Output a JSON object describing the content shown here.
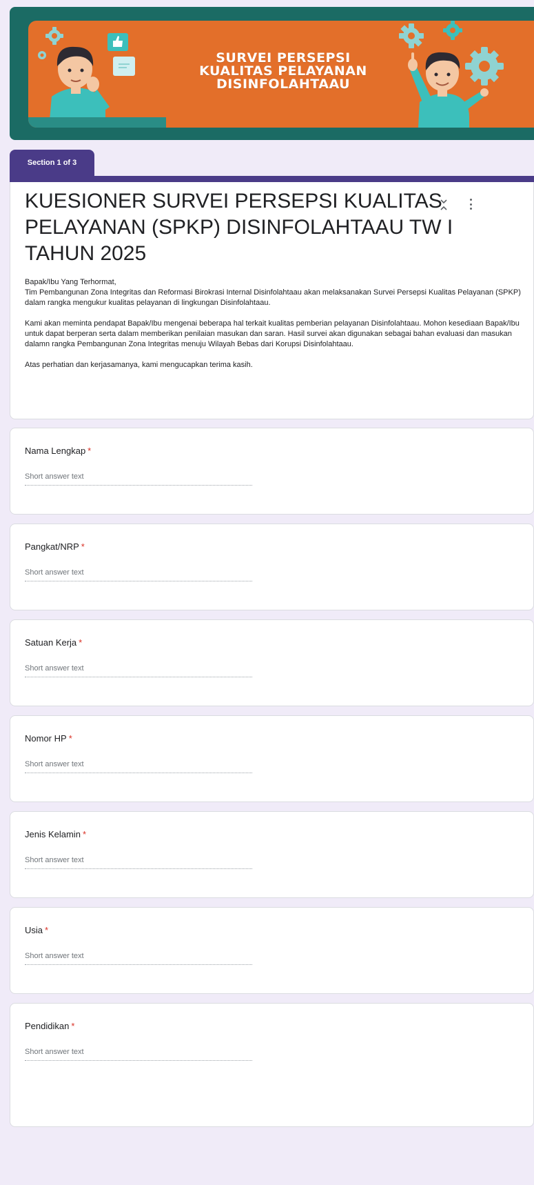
{
  "banner": {
    "title_line1": "SURVEI PERSEPSI",
    "title_line2": "KUALITAS PELAYANAN",
    "title_line3": "DISINFOLAHTAAU"
  },
  "section_label": "Section 1 of 3",
  "form": {
    "title": "KUESIONER SURVEI PERSEPSI KUALITAS PELAYANAN (SPKP) DISINFOLAHTAAU TW I TAHUN 2025",
    "description": {
      "greeting": "Bapak/Ibu Yang Terhormat,",
      "para1": "Tim Pembangunan Zona Integritas dan Reformasi Birokrasi Internal Disinfolahtaau akan melaksanakan Survei Persepsi Kualitas Pelayanan (SPKP) dalam rangka mengukur kualitas pelayanan di lingkungan Disinfolahtaau.",
      "para2": "Kami akan meminta pendapat Bapak/Ibu mengenai beberapa hal terkait kualitas pemberian pelayanan Disinfolahtaau. Mohon kesediaan Bapak/Ibu untuk dapat berperan serta dalam memberikan penilaian masukan dan saran. Hasil survei akan digunakan sebagai bahan evaluasi dan masukan dalamn rangka Pembangunan Zona Integritas menuju Wilayah Bebas dari Korupsi Disinfolahtaau.",
      "para3": "Atas perhatian dan kerjasamanya, kami mengucapkan terima kasih."
    }
  },
  "questions": [
    {
      "label": "Nama Lengkap",
      "required": "*",
      "placeholder": "Short answer text"
    },
    {
      "label": "Pangkat/NRP",
      "required": "*",
      "placeholder": "Short answer text"
    },
    {
      "label": "Satuan Kerja",
      "required": "*",
      "placeholder": "Short answer text"
    },
    {
      "label": "Nomor HP",
      "required": "*",
      "placeholder": "Short answer text"
    },
    {
      "label": "Jenis Kelamin",
      "required": "*",
      "placeholder": "Short answer text"
    },
    {
      "label": "Usia",
      "required": "*",
      "placeholder": "Short answer text"
    },
    {
      "label": "Pendidikan",
      "required": "*",
      "placeholder": "Short answer text"
    }
  ],
  "colors": {
    "background": "#f0ebf8",
    "accent": "#4a3b88",
    "banner_outer": "#1b6b64",
    "banner_inner": "#e36f2a",
    "required": "#d93025"
  },
  "icons": {
    "collapse": "collapse-icon",
    "more": "more-vert-icon"
  }
}
